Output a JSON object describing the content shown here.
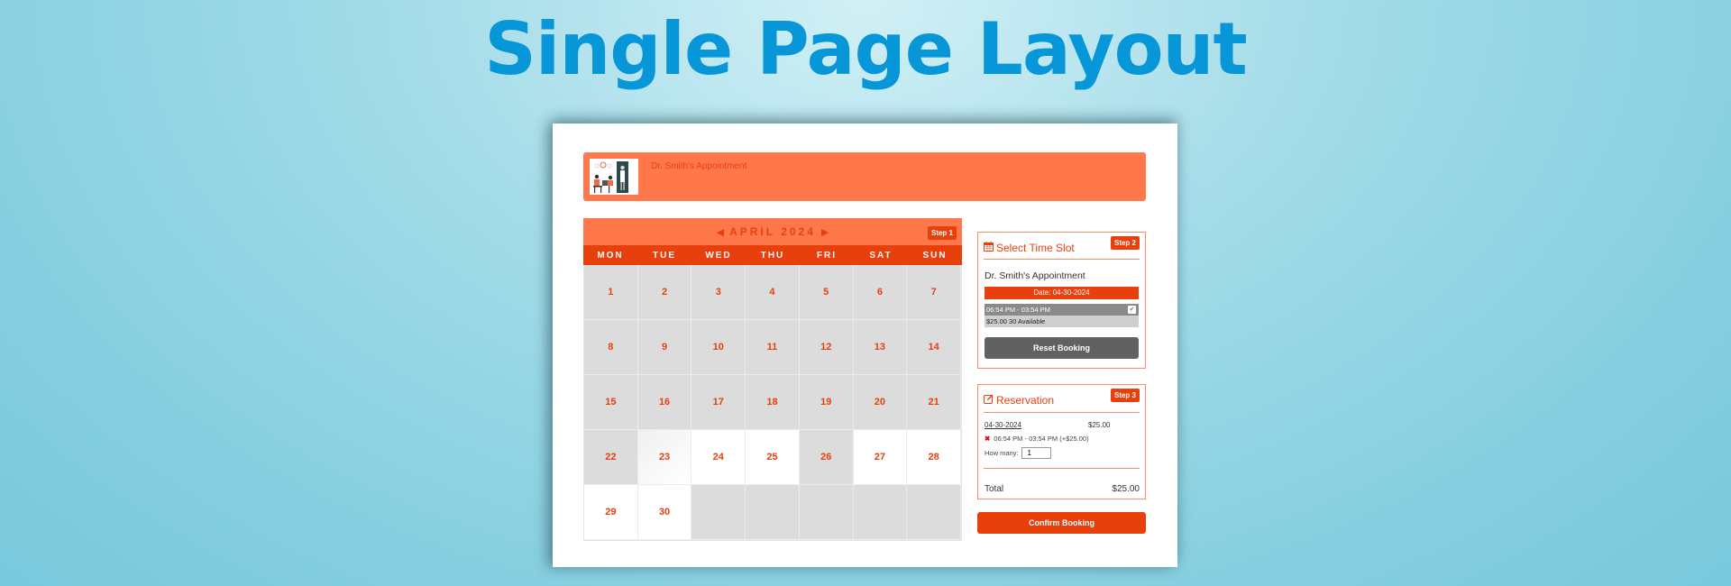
{
  "hero": {
    "title": "Single Page Layout"
  },
  "header": {
    "title": "Dr. Smith's Appointment",
    "thumbnail_icon": "doctor-clinic-illustration"
  },
  "calendar": {
    "month_label": "APRIL 2024",
    "prev_icon": "caret-left-icon",
    "next_icon": "caret-right-icon",
    "step_label": "Step 1",
    "weekdays": [
      "MON",
      "TUE",
      "WED",
      "THU",
      "FRI",
      "SAT",
      "SUN"
    ],
    "cells": [
      {
        "day": "1",
        "state": "unavailable"
      },
      {
        "day": "2",
        "state": "unavailable"
      },
      {
        "day": "3",
        "state": "unavailable"
      },
      {
        "day": "4",
        "state": "unavailable"
      },
      {
        "day": "5",
        "state": "unavailable"
      },
      {
        "day": "6",
        "state": "unavailable"
      },
      {
        "day": "7",
        "state": "unavailable"
      },
      {
        "day": "8",
        "state": "unavailable"
      },
      {
        "day": "9",
        "state": "unavailable"
      },
      {
        "day": "10",
        "state": "unavailable"
      },
      {
        "day": "11",
        "state": "unavailable"
      },
      {
        "day": "12",
        "state": "unavailable"
      },
      {
        "day": "13",
        "state": "unavailable"
      },
      {
        "day": "14",
        "state": "unavailable"
      },
      {
        "day": "15",
        "state": "unavailable"
      },
      {
        "day": "16",
        "state": "unavailable"
      },
      {
        "day": "17",
        "state": "unavailable"
      },
      {
        "day": "18",
        "state": "unavailable"
      },
      {
        "day": "19",
        "state": "unavailable"
      },
      {
        "day": "20",
        "state": "unavailable"
      },
      {
        "day": "21",
        "state": "unavailable"
      },
      {
        "day": "22",
        "state": "unavailable"
      },
      {
        "day": "23",
        "state": "hover"
      },
      {
        "day": "24",
        "state": "available"
      },
      {
        "day": "25",
        "state": "available"
      },
      {
        "day": "26",
        "state": "unavailable"
      },
      {
        "day": "27",
        "state": "available"
      },
      {
        "day": "28",
        "state": "available"
      },
      {
        "day": "29",
        "state": "available"
      },
      {
        "day": "30",
        "state": "available"
      },
      {
        "day": "",
        "state": "empty"
      },
      {
        "day": "",
        "state": "empty"
      },
      {
        "day": "",
        "state": "empty"
      },
      {
        "day": "",
        "state": "empty"
      },
      {
        "day": "",
        "state": "empty"
      }
    ]
  },
  "timeslot": {
    "title": "Select Time Slot",
    "icon": "calendar-icon",
    "step_label": "Step 2",
    "appointment_name": "Dr. Smith's Appointment",
    "date_label": "Date: 04-30-2024",
    "slot_time": "06:54 PM - 03:54 PM",
    "slot_checked": true,
    "slot_info": "$25.00  30 Available",
    "reset_label": "Reset Booking"
  },
  "reservation": {
    "title": "Reservation",
    "icon": "edit-icon",
    "step_label": "Step 3",
    "date": "04-30-2024",
    "price": "$25.00",
    "remove_icon": "x",
    "slot_text": "06:54 PM - 03:54 PM  (+$25.00)",
    "qty_label": "How many:",
    "qty_value": "1",
    "total_label": "Total",
    "total_value": "$25.00"
  },
  "confirm": {
    "label": "Confirm Booking"
  },
  "colors": {
    "accent": "#e8400c",
    "accent_light": "#ff784c",
    "title_blue": "#0797d8",
    "reset_gray": "#616161"
  }
}
